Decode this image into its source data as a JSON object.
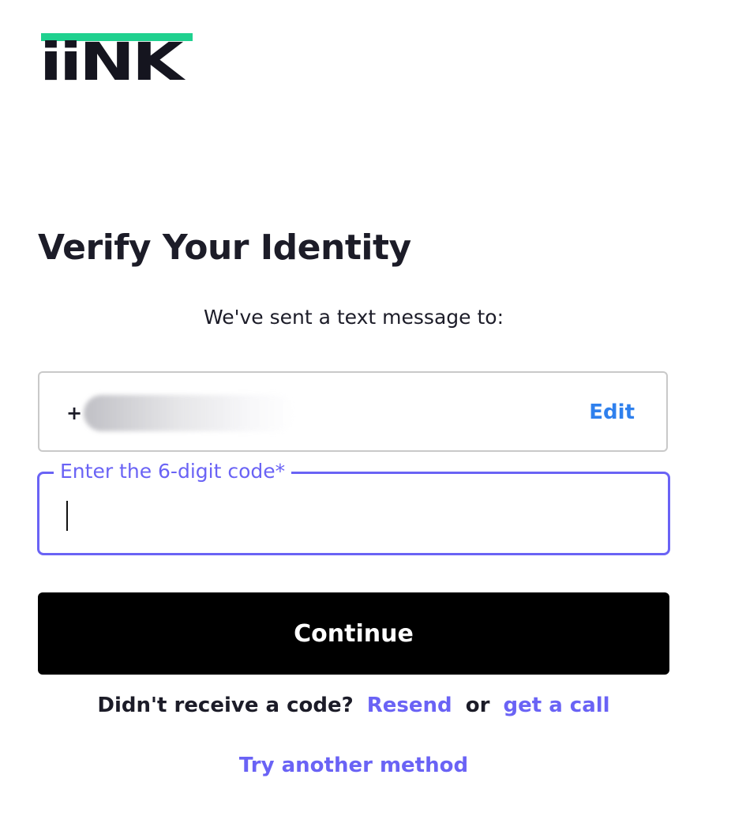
{
  "brand": {
    "logo_text": "iiNK",
    "accent_color": "#1fd18f",
    "logo_color": "#15151f"
  },
  "page": {
    "title": "Verify Your Identity",
    "sent_message": "We've sent a text message to:"
  },
  "phone": {
    "number_prefix": "+",
    "number_redacted": true,
    "edit_label": "Edit",
    "edit_color": "#2f80ed"
  },
  "code_field": {
    "label": "Enter the 6-digit code*",
    "value": "",
    "focus_color": "#6a63f5"
  },
  "actions": {
    "continue_label": "Continue",
    "continue_bg": "#000000",
    "no_code_text": "Didn't receive a code?",
    "resend_label": "Resend",
    "or_text": "or",
    "call_label": "get a call",
    "try_another_label": "Try another method",
    "link_color": "#6a63f5"
  }
}
